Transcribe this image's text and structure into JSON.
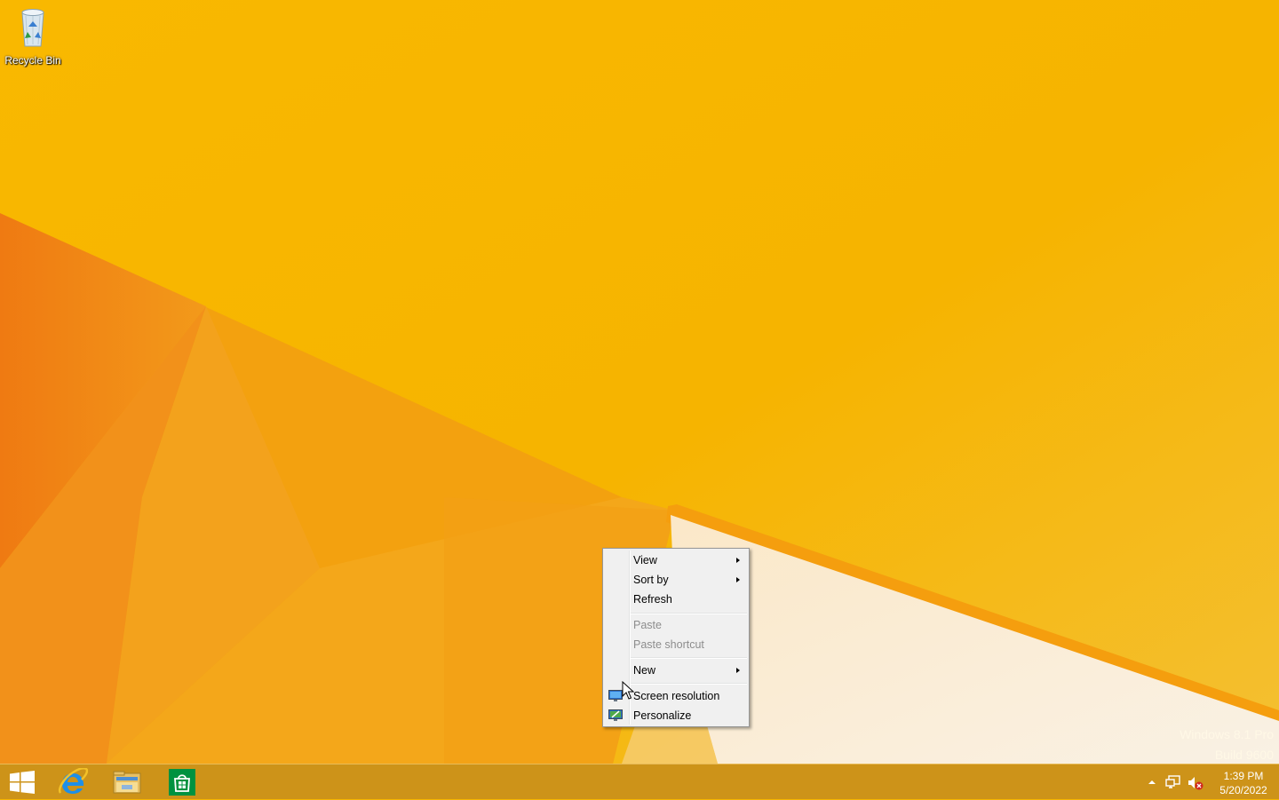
{
  "desktop": {
    "icons": [
      {
        "label": "Recycle Bin",
        "icon": "recycle-bin-icon"
      }
    ],
    "watermark": {
      "line1": "Windows 8.1 Pro",
      "line2": "Build 9600"
    }
  },
  "context_menu": {
    "items": [
      {
        "label": "View",
        "submenu": true,
        "enabled": true
      },
      {
        "label": "Sort by",
        "submenu": true,
        "enabled": true
      },
      {
        "label": "Refresh",
        "submenu": false,
        "enabled": true
      },
      {
        "label": "Paste",
        "submenu": false,
        "enabled": false
      },
      {
        "label": "Paste shortcut",
        "submenu": false,
        "enabled": false
      },
      {
        "label": "New",
        "submenu": true,
        "enabled": true
      },
      {
        "label": "Screen resolution",
        "submenu": false,
        "enabled": true,
        "icon": "screen-resolution-icon"
      },
      {
        "label": "Personalize",
        "submenu": false,
        "enabled": true,
        "icon": "personalize-icon"
      }
    ]
  },
  "taskbar": {
    "buttons": [
      {
        "name": "start",
        "icon": "windows-logo-icon"
      },
      {
        "name": "internet-explorer",
        "icon": "internet-explorer-icon"
      },
      {
        "name": "file-explorer",
        "icon": "file-explorer-icon"
      },
      {
        "name": "store",
        "icon": "store-icon"
      }
    ],
    "tray": {
      "icons": [
        "show-hidden-icons-arrow-icon",
        "network-icon",
        "volume-muted-icon"
      ],
      "time": "1:39 PM",
      "date": "5/20/2022"
    }
  },
  "colors": {
    "wallpaper_base": "#f5b400",
    "wallpaper_orange": "#ec7a10",
    "taskbar": "#c48b1e",
    "menu_bg": "#f0f0f0",
    "disabled_text": "#8d8d8d"
  }
}
